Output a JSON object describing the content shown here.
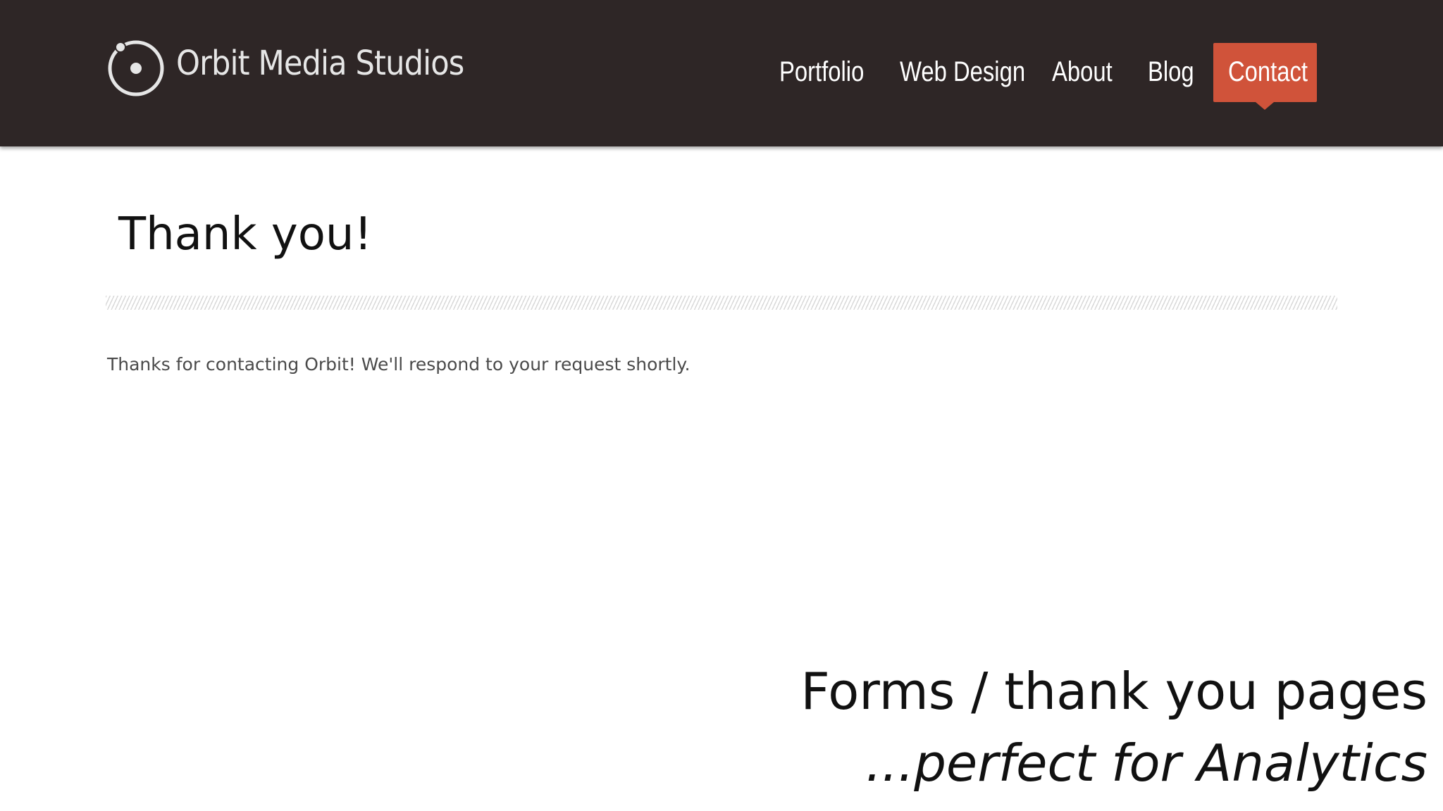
{
  "header": {
    "logo_text": "Orbit Media Studios",
    "logo_icon": "orbit-logo-icon",
    "background_color": "#2e2626",
    "nav": {
      "portfolio": "Portfolio",
      "web_design": "Web Design",
      "about": "About",
      "blog": "Blog",
      "contact": "Contact"
    },
    "active_nav": "contact",
    "active_color": "#d0533a"
  },
  "main": {
    "title": "Thank you!",
    "message": "Thanks for contacting Orbit! We'll respond to your request shortly."
  },
  "caption": {
    "line1": "Forms / thank you pages",
    "line2": "...perfect for Analytics"
  }
}
